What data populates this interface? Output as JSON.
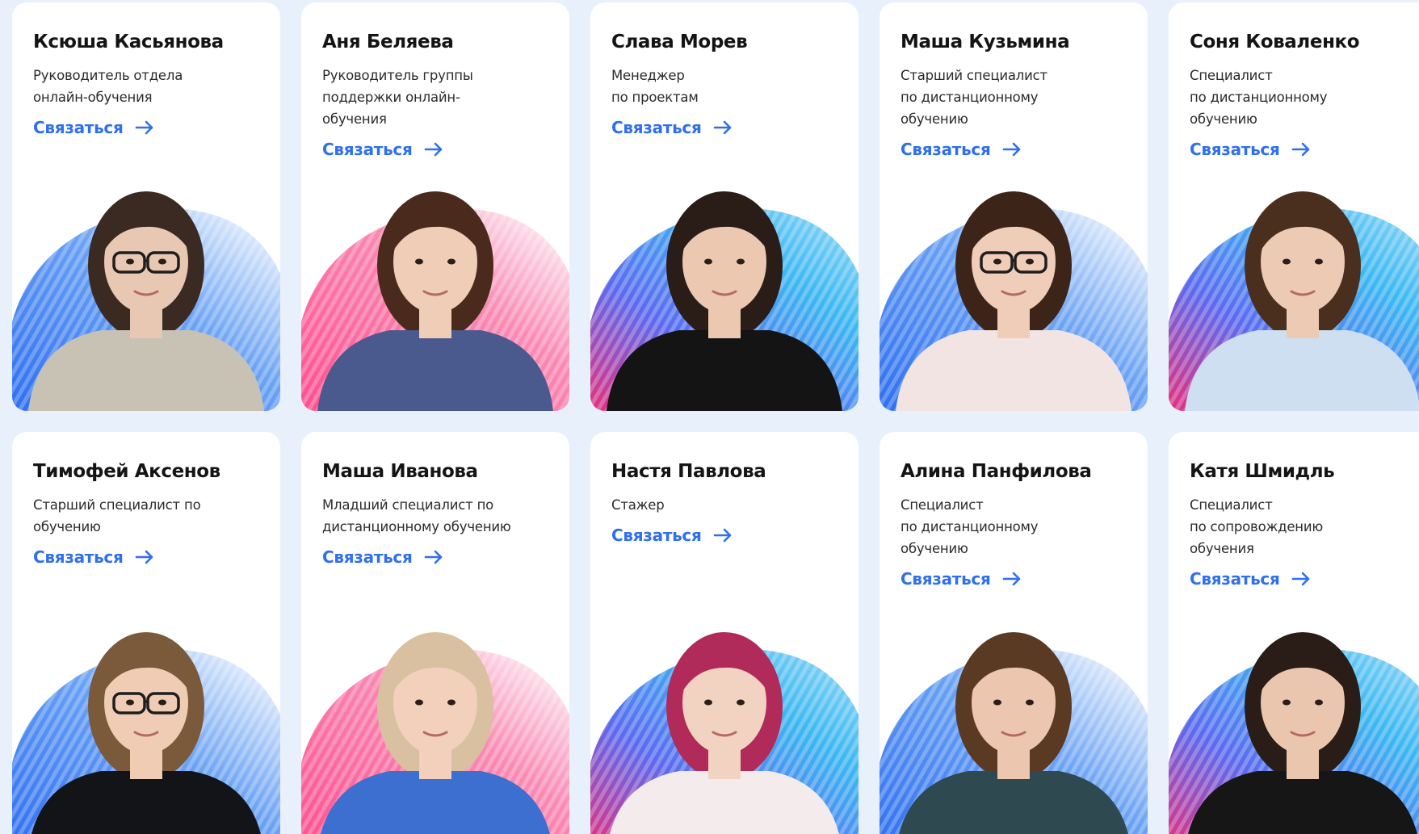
{
  "contact_label": "Связаться",
  "colors": {
    "accent": "#2f6ff0",
    "blue_arc": "#4e8ef2",
    "pink_arc": "#f26a9c",
    "cyan_arc": "#3fb6f0",
    "magenta_arc": "#e0368a"
  },
  "team": [
    {
      "name": "Ксюша Касьянова",
      "role": "Руководитель отдела онлайн-обучения",
      "arc": "blue",
      "hair": "#3a2a22",
      "top": "#c8c2b4",
      "skin": "#e8c8b2",
      "glasses": true
    },
    {
      "name": "Аня Беляева",
      "role": "Руководитель группы поддержки онлайн-обучения",
      "arc": "pink",
      "hair": "#4a2a1c",
      "top": "#4a5a8e",
      "skin": "#efcdb6",
      "glasses": false
    },
    {
      "name": "Слава Морев",
      "role": "Менеджер по проектам",
      "arc": "checker",
      "hair": "#2a1c16",
      "top": "#141414",
      "skin": "#ecc8b0",
      "glasses": false
    },
    {
      "name": "Маша Кузьмина",
      "role": "Старший специалист по дистанционному обучению",
      "arc": "blue",
      "hair": "#3c2418",
      "top": "#f3e4e4",
      "skin": "#f0cdb8",
      "glasses": true
    },
    {
      "name": "Соня Коваленко",
      "role": "Специалист по дистанционному обучению",
      "arc": "checker",
      "hair": "#4a2e1e",
      "top": "#cddff0",
      "skin": "#eccab4",
      "glasses": false
    },
    {
      "name": "Тимофей Аксенов",
      "role": "Старший специалист по обучению",
      "arc": "blue",
      "hair": "#7a5a3a",
      "top": "#121418",
      "skin": "#f0ccb4",
      "glasses": true
    },
    {
      "name": "Маша Иванова",
      "role": "Младший специалист по дистанционному обучению",
      "arc": "pink",
      "hair": "#d8c0a0",
      "top": "#3d6fd0",
      "skin": "#f2d0bc",
      "glasses": false
    },
    {
      "name": "Настя Павлова",
      "role": "Стажер",
      "arc": "checker",
      "hair": "#b02a5a",
      "top": "#f4ecec",
      "skin": "#f2d2c0",
      "glasses": false
    },
    {
      "name": "Алина Панфилова",
      "role": "Специалист по дистанционному обучению",
      "arc": "blue",
      "hair": "#5a3a22",
      "top": "#2e4a50",
      "skin": "#ecc6ae",
      "glasses": false
    },
    {
      "name": "Катя Шмидль",
      "role": "Специалист по сопровождению обучения",
      "arc": "checker",
      "hair": "#2a1c16",
      "top": "#161616",
      "skin": "#eac6ae",
      "glasses": false
    }
  ]
}
